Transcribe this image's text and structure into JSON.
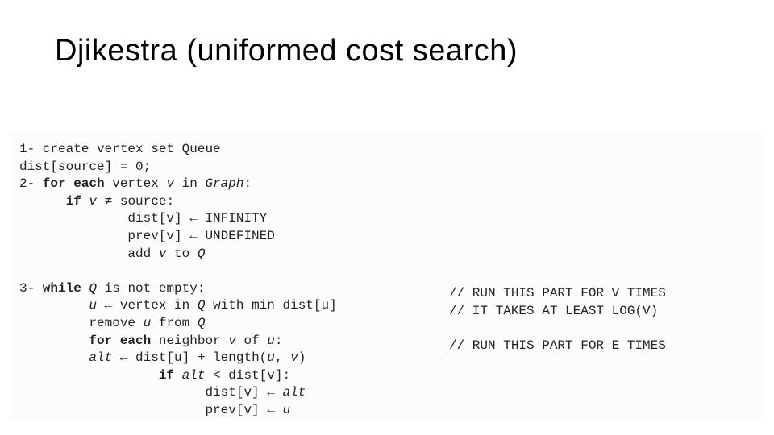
{
  "slide": {
    "title": "Djikestra (uniformed cost search)",
    "code": {
      "l01a": "1- create vertex set Queue",
      "l02a": "dist[source] = 0;",
      "l03a": "2-",
      "l03b": " for each",
      "l03c": " vertex ",
      "l03d": "v",
      "l03e": " in ",
      "l03f": "Graph",
      "l03g": ":",
      "l04a": "      ",
      "l04b": "if",
      "l04c": " ",
      "l04d": "v",
      "l04e": " ≠ source:",
      "l05a": "              dist[v] ← INFINITY",
      "l06a": "              prev[v] ← UNDEFINED",
      "l07a": "              add ",
      "l07b": "v",
      "l07c": " to ",
      "l07d": "Q",
      "blank1": "",
      "l08a": "3-",
      "l08b": " while",
      "l08c": " ",
      "l08d": "Q",
      "l08e": " is not empty:",
      "l09a": "         ",
      "l09b": "u",
      "l09c": " ← vertex in ",
      "l09d": "Q",
      "l09e": " with min dist[u]",
      "l10a": "         remove ",
      "l10b": "u",
      "l10c": " from ",
      "l10d": "Q",
      "l11a": "         ",
      "l11b": "for each",
      "l11c": " neighbor ",
      "l11d": "v",
      "l11e": " of ",
      "l11f": "u",
      "l11g": ":",
      "l12a": "         ",
      "l12b": "alt",
      "l12c": " ← dist[u] + length(",
      "l12d": "u",
      "l12e": ", ",
      "l12f": "v",
      "l12g": ")",
      "l13a": "                  ",
      "l13b": "if",
      "l13c": " ",
      "l13d": "alt",
      "l13e": " < dist[v]:",
      "l14a": "                        dist[v] ← ",
      "l14b": "alt",
      "l15a": "                        prev[v] ← ",
      "l15b": "u"
    },
    "comments": {
      "c1": "// RUN THIS PART FOR V TIMES",
      "c2": "// IT TAKES AT LEAST LOG(V)",
      "blank": "",
      "c3": "// RUN THIS PART FOR E TIMES"
    }
  }
}
